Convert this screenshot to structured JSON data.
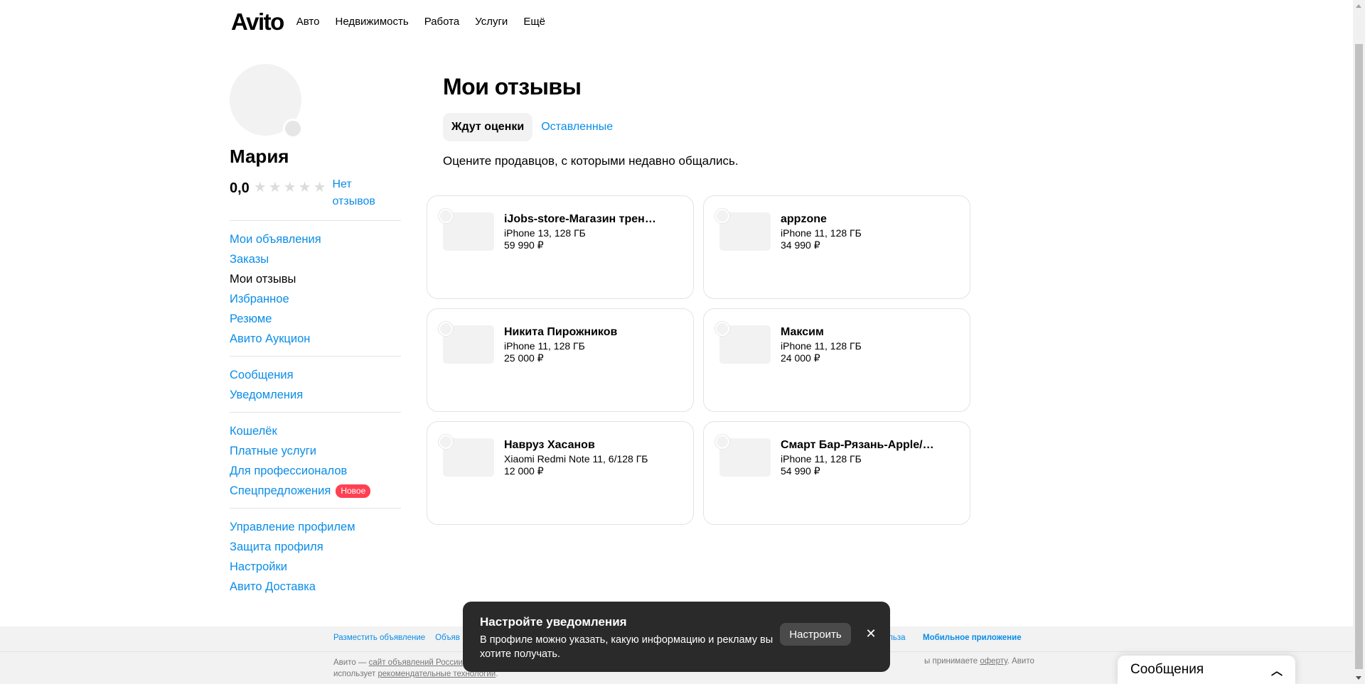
{
  "header": {
    "logo": "Avito",
    "nav": [
      "Авто",
      "Недвижимость",
      "Работа",
      "Услуги",
      "Ещё"
    ]
  },
  "profile": {
    "name": "Мария",
    "rating": "0,0",
    "no_reviews": "Нет отзывов",
    "stars_filled": 0,
    "stars_total": 5
  },
  "sidebar": {
    "group1": [
      "Мои объявления",
      "Заказы",
      "Мои отзывы",
      "Избранное",
      "Резюме",
      "Авито Аукцион"
    ],
    "group2": [
      "Сообщения",
      "Уведомления"
    ],
    "group3": [
      "Кошелёк",
      "Платные услуги",
      "Для профессионалов",
      "Спецпредложения"
    ],
    "badge_new": "Новое",
    "group4": [
      "Управление профилем",
      "Защита профиля",
      "Настройки",
      "Авито Доставка"
    ]
  },
  "main": {
    "title": "Мои отзывы",
    "tabs": [
      "Ждут оценки",
      "Оставленные"
    ],
    "intro": "Оцените продавцов, с которыми недавно общались."
  },
  "cards": [
    {
      "seller": "iJobs-store-Магазин трен…",
      "item": "iPhone 13, 128 ГБ",
      "price": "59 990 ₽"
    },
    {
      "seller": "appzone",
      "item": "iPhone 11, 128 ГБ",
      "price": "34 990 ₽"
    },
    {
      "seller": "Никита Пирожников",
      "item": "iPhone 11, 128 ГБ",
      "price": "25 000 ₽"
    },
    {
      "seller": "Максим",
      "item": "iPhone 11, 128 ГБ",
      "price": "24 000 ₽"
    },
    {
      "seller": "Навруз Хасанов",
      "item": "Xiaomi Redmi Note 11, 6/128 ГБ",
      "price": "12 000 ₽"
    },
    {
      "seller": "Смарт Бар-Рязань-Apple/…",
      "item": "iPhone 11, 128 ГБ",
      "price": "54 990 ₽"
    }
  ],
  "footer": {
    "link1": "Разместить объявление",
    "link2": "Объяв",
    "link3": "ольза",
    "link4": "Мобильное приложение",
    "text_prefix": "Авито — ",
    "text_link": "сайт объявлений России",
    "text_line2_prefix": "использует ",
    "text_line2_link": "рекомендательные технологии",
    "text_right_prefix": "ы принимаете ",
    "text_right_link": "оферту",
    "text_right_suffix": ". Авито"
  },
  "toast": {
    "title": "Настройте уведомления",
    "body": "В профиле можно указать, какую информацию и рекламу вы хотите получать.",
    "button": "Настроить",
    "close": "✕"
  },
  "messages_widget": {
    "title": "Сообщения",
    "chevron": "︿"
  },
  "colors": {
    "accent": "#0a8de8",
    "badge": "#ff4053",
    "toast_bg": "#2a2a2a"
  }
}
